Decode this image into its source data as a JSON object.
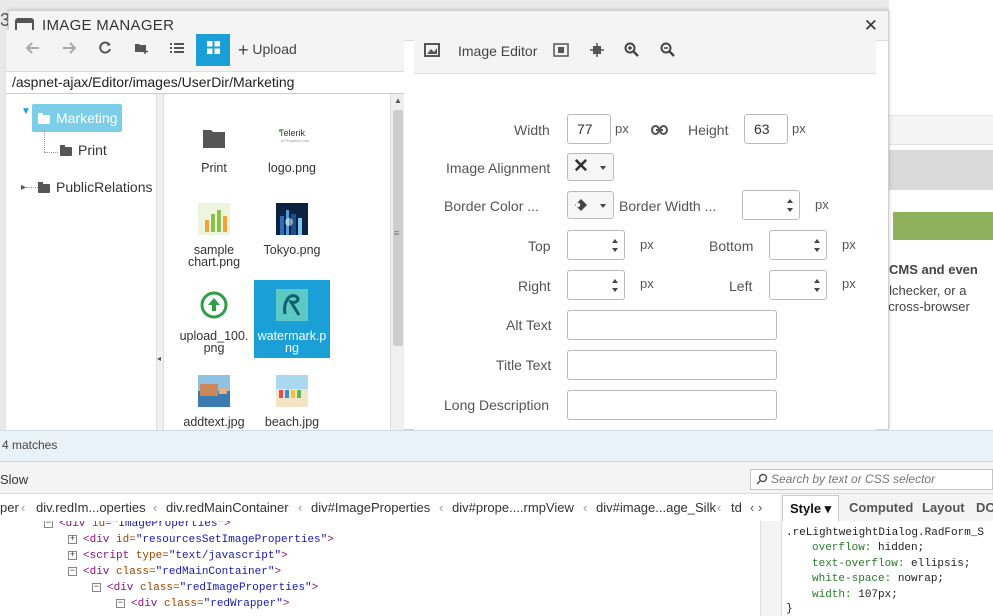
{
  "background": {
    "lines": [
      "CMS and even",
      "ellchecker, or a",
      "t cross-browser"
    ]
  },
  "dialog": {
    "title": "IMAGE MANAGER",
    "close_icon": "✕",
    "toolbar": {
      "upload_label": "Upload"
    },
    "path": "/aspnet-ajax/Editor/images/UserDir/Marketing",
    "tree": [
      {
        "label": "Marketing",
        "selected": true
      },
      {
        "label": "Print"
      },
      {
        "label": "PublicRelations"
      }
    ],
    "files": [
      {
        "name": "Print",
        "icon": "folder-icon"
      },
      {
        "name": "logo.png",
        "icon": "telerik-logo-icon"
      },
      {
        "name": "sample chart.png",
        "icon": "chart-thumbnail"
      },
      {
        "name": "Tokyo.png",
        "icon": "city-thumbnail"
      },
      {
        "name": "upload_100. png",
        "icon": "upload-thumbnail"
      },
      {
        "name": "watermark.p ng",
        "icon": "watermark-thumbnail",
        "selected": true
      },
      {
        "name": "addtext.jpg",
        "icon": "harbor-thumbnail"
      },
      {
        "name": "beach.jpg",
        "icon": "beach-thumbnail"
      }
    ]
  },
  "editor": {
    "title": "Image Editor",
    "fields": {
      "width_label": "Width",
      "width_value": "77",
      "height_label": "Height",
      "height_value": "63",
      "unit": "px",
      "alignment_label": "Image Alignment",
      "border_color_label": "Border Color ...",
      "border_width_label": "Border Width ...",
      "top_label": "Top",
      "bottom_label": "Bottom",
      "right_label": "Right",
      "left_label": "Left",
      "alt_text_label": "Alt Text",
      "title_text_label": "Title Text",
      "long_desc_label": "Long Description"
    }
  },
  "devtools": {
    "matches": "4 matches",
    "slow_label": "Slow",
    "search_placeholder": "Search by text or CSS selector",
    "breadcrumbs": [
      "per",
      "div.redIm...operties",
      "div.redMainContainer",
      "div#ImageProperties",
      "div#prope....rmpView",
      "div#image...age_Silk",
      "td"
    ],
    "side_tabs": [
      "Style ▾",
      "Computed",
      "Layout",
      "DO"
    ],
    "dom_lines": [
      {
        "indent": 0,
        "exp": "⊟",
        "html": [
          "<div ",
          "id=",
          "\"ImageProperties\"",
          ">"
        ]
      },
      {
        "indent": 1,
        "exp": "⊞",
        "html": [
          "<div ",
          "id=",
          "\"resourcesSetImageProperties\"",
          ">"
        ]
      },
      {
        "indent": 1,
        "exp": "⊞",
        "html": [
          "<script ",
          "type=",
          "\"text/javascript\"",
          ">"
        ]
      },
      {
        "indent": 1,
        "exp": "⊟",
        "html": [
          "<div ",
          "class=",
          "\"redMainContainer\"",
          ">"
        ]
      },
      {
        "indent": 2,
        "exp": "⊟",
        "html": [
          "<div ",
          "class=",
          "\"redImageProperties\"",
          ">"
        ]
      },
      {
        "indent": 3,
        "exp": "⊟",
        "html": [
          "<div ",
          "class=",
          "\"redWrapper\"",
          ">"
        ]
      }
    ],
    "css_rule": {
      "selector": ".reLightweightDialog.RadForm_S",
      "props": [
        [
          "overflow",
          "hidden;"
        ],
        [
          "text-overflow",
          "ellipsis;"
        ],
        [
          "white-space",
          "nowrap;"
        ],
        [
          "width",
          "107px;"
        ]
      ],
      "close": "}"
    }
  }
}
